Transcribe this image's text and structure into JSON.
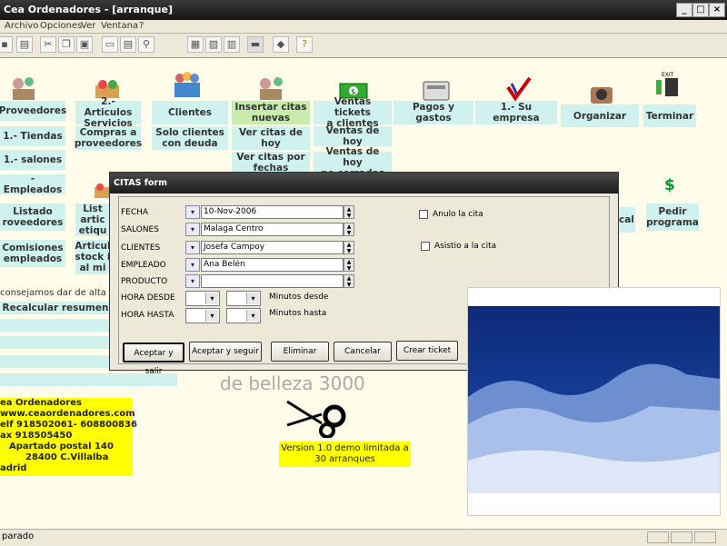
{
  "window": {
    "title": "Cea Ordenadores  - [arranque]"
  },
  "menu": [
    "Archivo",
    "Opciones",
    "Ver",
    "Ventana",
    "?"
  ],
  "grid": {
    "proveedores": "Proveedores",
    "articulos": "2.- Articulos\nServicios",
    "clientes": "Clientes",
    "insertar_citas": "Insertar citas\nnuevas",
    "ventas_tickets": "Ventas tickets\na clientes",
    "pagos_gastos": "Pagos y gastos",
    "su_empresa": "1.- Su empresa",
    "organizar": "Organizar",
    "terminar": "Terminar",
    "tiendas": "1.- Tiendas",
    "compras": "Compras a\nproveedores",
    "deuda": "Solo clientes\ncon deuda",
    "ver_citas_hoy": "Ver citas de\nhoy",
    "ventas_hoy": "Ventas de hoy",
    "salones": "1.- salones",
    "ver_citas_fechas": "Ver citas por\nfechas",
    "ventas_no_cerradas": "Ventas de hoy\nno cerradas",
    "empleados": "- Empleados",
    "listado_prov": "Listado\nroveedores",
    "list_art": "List\nartic\netiqu",
    "cal": "cal",
    "pedir": "Pedir\nprograma",
    "comisiones": "Comisiones\nempleados",
    "articulos_stock": "Articul\nstock i\nal mi",
    "advice": "consejamos dar de alta en e",
    "recalcular": "Recalcular resumen"
  },
  "dialog": {
    "title": "CITAS form",
    "labels": {
      "fecha": "FECHA",
      "salones": "SALONES",
      "clientes": "CLIENTES",
      "empleado": "EMPLEADO",
      "producto": "PRODUCTO",
      "hora_desde": "HORA DESDE",
      "hora_hasta": "HORA HASTA",
      "min_desde": "Minutos desde",
      "min_hasta": "Minutos hasta"
    },
    "values": {
      "fecha": "10-Nov-2006",
      "salones": "Malaga Centro",
      "clientes": "Josefa Campoy",
      "empleado": "Ana Belén",
      "producto": ""
    },
    "checks": {
      "anulo": "Anulo la cita",
      "asistio": "Asistio a la cita"
    },
    "buttons": {
      "aceptar_salir": "Aceptar y salir",
      "aceptar_seguir": "Aceptar y seguir",
      "eliminar": "Eliminar",
      "cancelar": "Cancelar",
      "crear_ticket": "Crear ticket"
    }
  },
  "belleza": "de belleza 3000",
  "contact": [
    "ea Ordenadores",
    "www.ceaordenadores.com",
    "elf 918502061- 608800836",
    "ax 918505450",
    "Apartado postal 140",
    "28400 C.Villalba",
    "adrid"
  ],
  "version": "Version 1.0 demo limitada a\n30 arranques",
  "status": "parado"
}
